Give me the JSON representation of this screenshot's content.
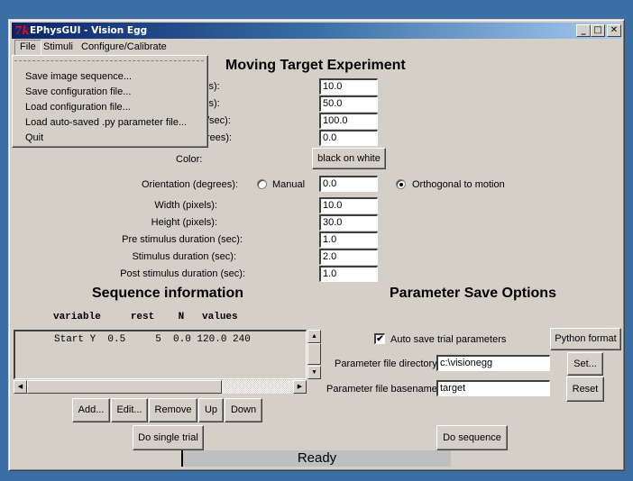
{
  "window": {
    "title": "EPhysGUI - Vision Egg",
    "controls": {
      "minimize": "_",
      "maximize": "□",
      "close": "✕"
    }
  },
  "menubar": {
    "items": [
      {
        "label": "File",
        "active": true
      },
      {
        "label": "Stimuli"
      },
      {
        "label": "Configure/Calibrate"
      }
    ]
  },
  "file_menu": {
    "items": [
      "Save image sequence...",
      "Save configuration file...",
      "Load configuration file...",
      "Load auto-saved .py parameter file...",
      "Quit"
    ]
  },
  "experiment": {
    "title": "Moving Target Experiment",
    "partial_labels": [
      "ls):",
      "ls):",
      "/sec):",
      "rees):"
    ],
    "top_values": [
      "10.0",
      "50.0",
      "100.0",
      "0.0"
    ],
    "color_label": "Color:",
    "color_button": "black on white",
    "orientation_label": "Orientation (degrees):",
    "orientation_manual_label": "Manual",
    "orientation_value": "0.0",
    "orientation_orthogonal_label": "Orthogonal to motion",
    "orientation_selected": "Orthogonal to motion",
    "fields": [
      {
        "label": "Width (pixels):",
        "value": "10.0"
      },
      {
        "label": "Height (pixels):",
        "value": "30.0"
      },
      {
        "label": "Pre stimulus duration (sec):",
        "value": "1.0"
      },
      {
        "label": "Stimulus duration (sec):",
        "value": "2.0"
      },
      {
        "label": "Post stimulus duration (sec):",
        "value": "1.0"
      }
    ]
  },
  "sequence": {
    "title": "Sequence information",
    "header": "variable     rest    N   values",
    "rows": [
      "     Start Y  0.5     5  0.0 120.0 240"
    ],
    "buttons": {
      "add": "Add...",
      "edit": "Edit...",
      "remove": "Remove",
      "up": "Up",
      "down": "Down"
    },
    "single_trial": "Do single trial",
    "scroll_up": "▲",
    "scroll_down": "▼",
    "scroll_left": "◀",
    "scroll_right": "▶"
  },
  "param_save": {
    "title": "Parameter Save Options",
    "auto_save_label": "Auto save trial parameters",
    "auto_save_checked": "✔",
    "python_format": "Python format",
    "dir_label": "Parameter file directory:",
    "dir_value": "c:\\visionegg",
    "set_button": "Set...",
    "basename_label": "Parameter file basename:",
    "basename_value": "target",
    "reset_button": "Reset",
    "do_sequence": "Do sequence"
  },
  "status": {
    "text": "Ready",
    "progress": 0
  }
}
